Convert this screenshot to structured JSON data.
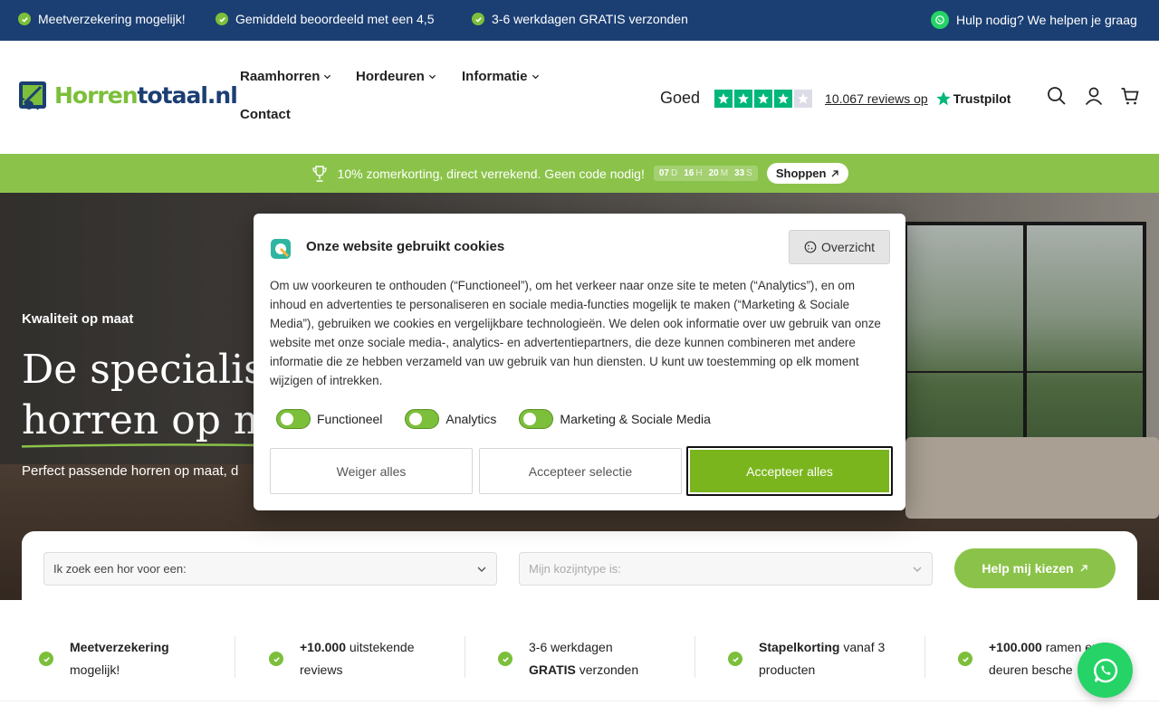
{
  "topbar": {
    "usps": [
      "Meetverzekering mogelijk!",
      "Gemiddeld beoordeeld met een 4,5",
      "3-6 werkdagen GRATIS verzonden"
    ],
    "help": "Hulp nodig? We helpen je graag"
  },
  "header": {
    "logo_part1": "Horren",
    "logo_part2": "totaal.nl",
    "nav": [
      "Raamhorren",
      "Hordeuren",
      "Informatie",
      "Contact"
    ],
    "trustpilot": {
      "label": "Goed",
      "stars": 4,
      "reviews": "10.067 reviews op",
      "brand": "Trustpilot"
    }
  },
  "promo": {
    "text": "10% zomerkorting, direct verrekend. Geen code nodig!",
    "countdown": [
      {
        "value": "07",
        "unit": "D"
      },
      {
        "value": "16",
        "unit": "H"
      },
      {
        "value": "20",
        "unit": "M"
      },
      {
        "value": "33",
        "unit": "S"
      }
    ],
    "button": "Shoppen"
  },
  "hero": {
    "kicker": "Kwaliteit op maat",
    "title_line1": "De specialist",
    "title_line2": "horren op ma",
    "subtitle": "Perfect passende horren op maat, d"
  },
  "finder": {
    "select1": "Ik zoek een hor voor een:",
    "select2": "Mijn kozijntype is:",
    "button": "Help mij kiezen"
  },
  "usps": [
    {
      "bold": "Meetverzekering",
      "rest": "mogelijk!"
    },
    {
      "bold": "+10.000",
      "rest_line1": "uitstekende",
      "line2": "reviews"
    },
    {
      "line1": "3-6 werkdagen",
      "bold": "GRATIS",
      "rest": "verzonden"
    },
    {
      "bold": "Stapelkorting",
      "rest_line1": "vanaf 3",
      "line2": "producten"
    },
    {
      "bold": "+100.000",
      "rest_line1": "ramen en",
      "line2": "deuren besche"
    }
  ],
  "cookie": {
    "title": "Onze website gebruikt cookies",
    "overview": "Overzicht",
    "text": "Om uw voorkeuren te onthouden (“Functioneel”), om het verkeer naar onze site te meten (“Analytics”), en om inhoud en advertenties te personaliseren en sociale media-functies mogelijk te maken (“Marketing & Sociale Media”), gebruiken we cookies en vergelijkbare technologieën. We delen ook informatie over uw gebruik van onze website met onze sociale media-, analytics- en advertentiepartners, die deze kunnen combineren met andere informatie die ze hebben verzameld van uw gebruik van hun diensten. U kunt uw toestemming op elk moment wijzigen of intrekken.",
    "toggles": [
      "Functioneel",
      "Analytics",
      "Marketing & Sociale Media"
    ],
    "buttons": {
      "reject": "Weiger alles",
      "selection": "Accepteer selectie",
      "accept": "Accepteer alles"
    }
  },
  "colors": {
    "navy": "#1b3f73",
    "green": "#8bc34a",
    "accept": "#7ab51d",
    "trustpilot": "#00b67a",
    "whatsapp": "#25d366"
  }
}
